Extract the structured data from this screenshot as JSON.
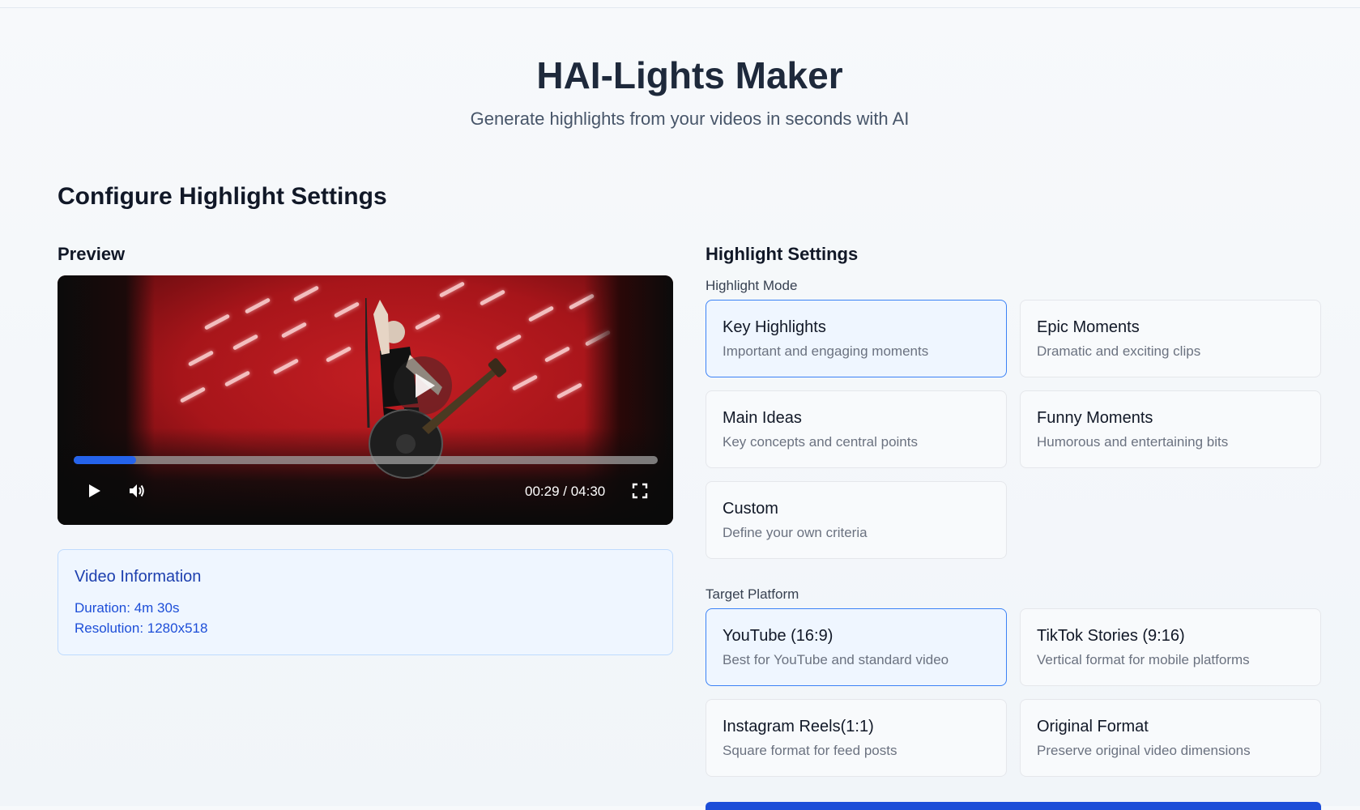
{
  "header": {
    "title": "HAI-Lights Maker",
    "subtitle": "Generate highlights from your videos in seconds with AI"
  },
  "section_title": "Configure Highlight Settings",
  "preview": {
    "title": "Preview",
    "player": {
      "time_display": "00:29 / 04:30",
      "progress_fraction": 0.107
    }
  },
  "video_info": {
    "title": "Video Information",
    "duration": "Duration: 4m 30s",
    "resolution": "Resolution: 1280x518"
  },
  "settings": {
    "title": "Highlight Settings",
    "mode_label": "Highlight Mode",
    "modes": [
      {
        "title": "Key Highlights",
        "desc": "Important and engaging moments",
        "selected": true
      },
      {
        "title": "Epic Moments",
        "desc": "Dramatic and exciting clips",
        "selected": false
      },
      {
        "title": "Main Ideas",
        "desc": "Key concepts and central points",
        "selected": false
      },
      {
        "title": "Funny Moments",
        "desc": "Humorous and entertaining bits",
        "selected": false
      },
      {
        "title": "Custom",
        "desc": "Define your own criteria",
        "selected": false
      }
    ],
    "platform_label": "Target Platform",
    "platforms": [
      {
        "title": "YouTube (16:9)",
        "desc": "Best for YouTube and standard video",
        "selected": true
      },
      {
        "title": "TikTok Stories (9:16)",
        "desc": "Vertical format for mobile platforms",
        "selected": false
      },
      {
        "title": "Instagram Reels(1:1)",
        "desc": "Square format for feed posts",
        "selected": false
      },
      {
        "title": "Original Format",
        "desc": "Preserve original video dimensions",
        "selected": false
      }
    ]
  },
  "colors": {
    "accent": "#2563eb",
    "selected_bg": "#eff6ff",
    "selected_border": "#3b82f6"
  }
}
